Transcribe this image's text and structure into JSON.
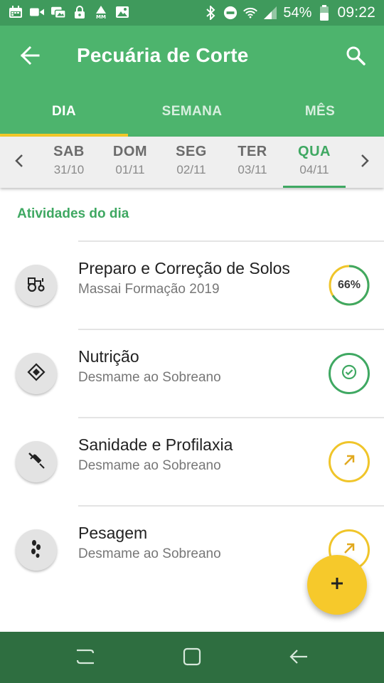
{
  "status_bar": {
    "battery_percent": "54%",
    "time": "09:22",
    "icons": [
      "calendar-icon",
      "video-icon",
      "photo-message-icon",
      "lock-icon",
      "mm-icon",
      "image-icon",
      "bluetooth-icon",
      "do-not-disturb-icon",
      "wifi-icon",
      "signal-icon",
      "battery-icon"
    ]
  },
  "app_bar": {
    "title": "Pecuária de Corte",
    "back_icon": "arrow-left-icon",
    "search_icon": "search-icon",
    "background_color": "#4db46d"
  },
  "tabs": [
    {
      "label": "DIA",
      "active": true
    },
    {
      "label": "SEMANA",
      "active": false
    },
    {
      "label": "MÊS",
      "active": false
    }
  ],
  "days": [
    {
      "name": "SAB",
      "date": "31/10",
      "active": false
    },
    {
      "name": "DOM",
      "date": "01/11",
      "active": false
    },
    {
      "name": "SEG",
      "date": "02/11",
      "active": false
    },
    {
      "name": "TER",
      "date": "03/11",
      "active": false
    },
    {
      "name": "QUA",
      "date": "04/11",
      "active": true
    }
  ],
  "section": {
    "title": "Atividades do dia"
  },
  "activities": [
    {
      "title": "Preparo e Correção de Solos",
      "subtitle": "Massai Formação 2019",
      "icon": "tractor-icon",
      "status": "progress",
      "progress_label": "66%",
      "progress": 0.66
    },
    {
      "title": "Nutrição",
      "subtitle": "Desmame ao Sobreano",
      "icon": "feed-icon",
      "status": "done"
    },
    {
      "title": "Sanidade e Profilaxia",
      "subtitle": "Desmame ao Sobreano",
      "icon": "syringe-icon",
      "status": "pending"
    },
    {
      "title": "Pesagem",
      "subtitle": "Desmame ao Sobreano",
      "icon": "footprints-icon",
      "status": "pending"
    }
  ],
  "fab": {
    "icon": "plus-icon",
    "color": "#f6c92b"
  },
  "colors": {
    "accent_green": "#3fa862",
    "accent_yellow": "#f0c52a",
    "nav_bar": "#2e6e40"
  }
}
